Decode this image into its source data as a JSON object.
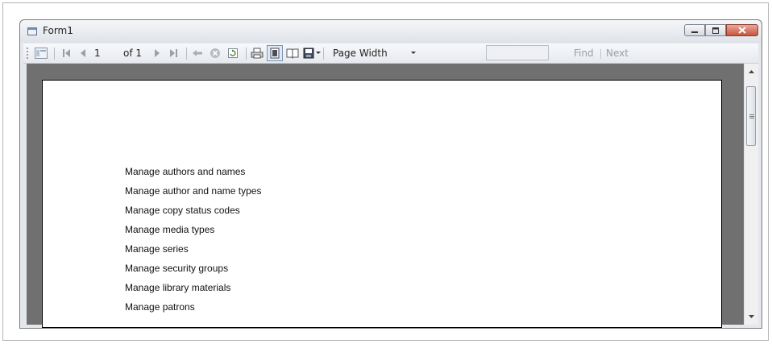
{
  "window": {
    "title": "Form1"
  },
  "toolbar": {
    "page_current": "1",
    "page_total": "of 1",
    "zoom_value": "Page Width",
    "find_placeholder": "",
    "find_label": "Find",
    "next_label": "Next"
  },
  "report": {
    "lines": [
      "Manage authors and names",
      "Manage author and name types",
      "Manage copy status codes",
      "Manage media types",
      "Manage series",
      "Manage security groups",
      "Manage library materials",
      "Manage patrons"
    ]
  },
  "colors": {
    "viewer_bg": "#707070",
    "close_btn": "#c8543d"
  }
}
